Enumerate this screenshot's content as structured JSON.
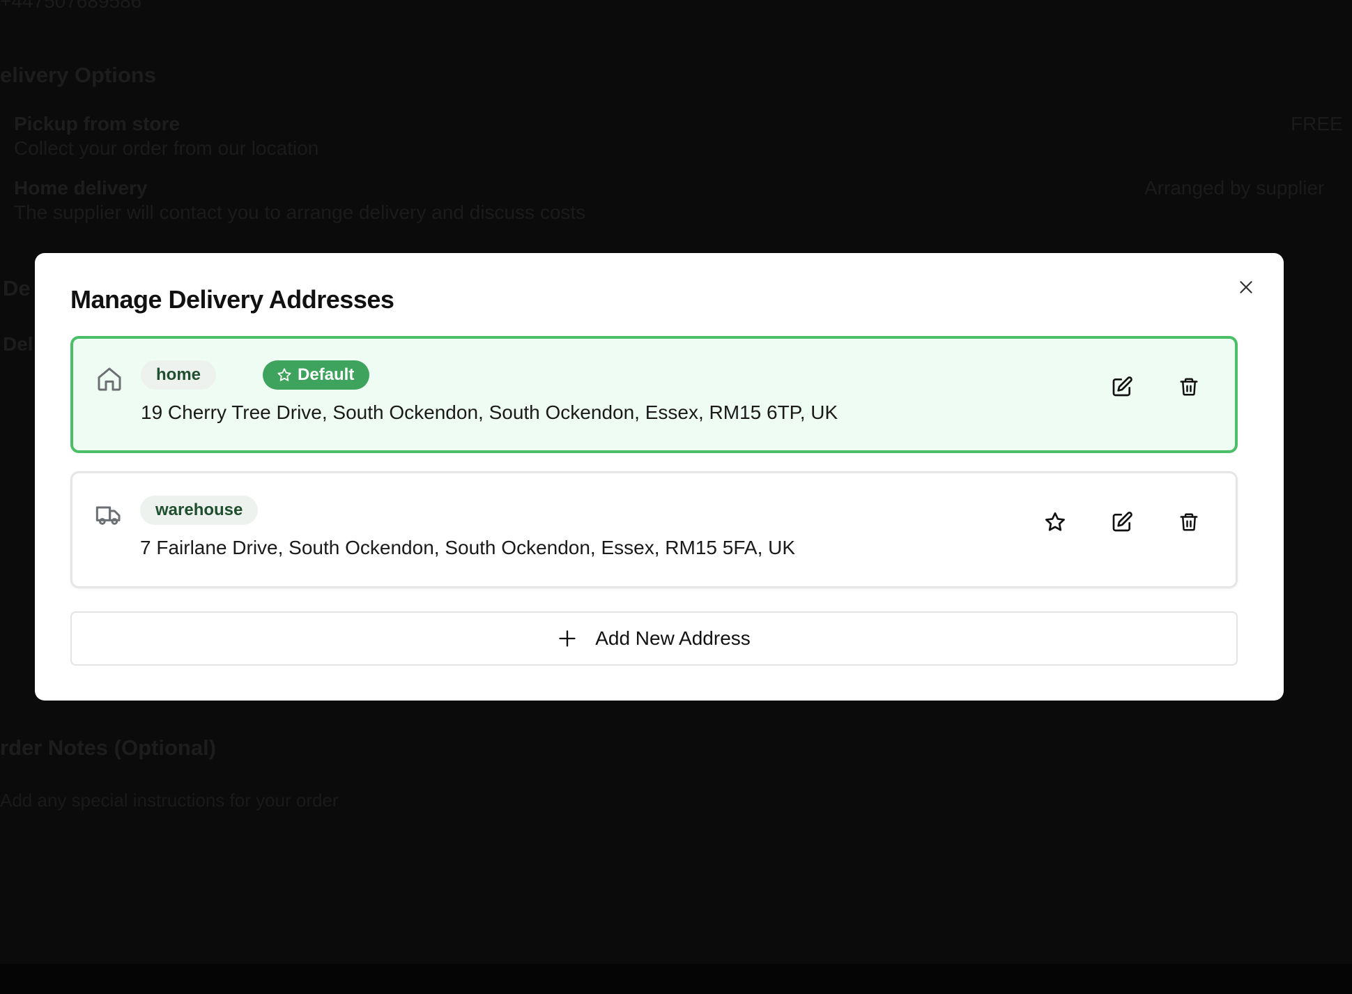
{
  "background": {
    "phone_partial": "+447507689586",
    "delivery_options_title": "elivery Options",
    "options": [
      {
        "title": "Pickup from store",
        "description": "Collect your order from our location",
        "price": "FREE"
      },
      {
        "title": "Home delivery",
        "description": "The supplier will contact you to arrange delivery and discuss costs",
        "price": "Arranged by supplier"
      }
    ],
    "delivery_address_partial": "De",
    "delivery_address_sub_partial": "Del",
    "order_notes_title": "rder Notes (Optional)",
    "order_notes_placeholder": "Add any special instructions for your order"
  },
  "modal": {
    "title": "Manage Delivery Addresses",
    "close_icon": "close-icon",
    "addresses": [
      {
        "label": "home",
        "icon": "home-icon",
        "is_default": true,
        "default_badge": "Default",
        "address": "19 Cherry Tree Drive, South Ockendon, South Ockendon, Essex, RM15 6TP, UK"
      },
      {
        "label": "warehouse",
        "icon": "truck-icon",
        "is_default": false,
        "address": "7 Fairlane Drive, South Ockendon, South Ockendon, Essex, RM15 5FA, UK"
      }
    ],
    "add_button_label": "Add New Address",
    "colors": {
      "default_border": "#4bbf68",
      "default_bg": "#effcf3",
      "default_badge_bg": "#3ea35c",
      "chip_text": "#1f4f2e"
    }
  }
}
